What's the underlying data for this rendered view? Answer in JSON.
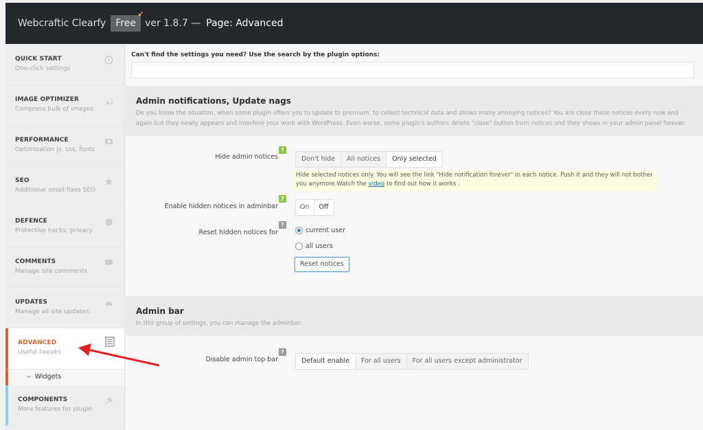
{
  "header": {
    "brand": "Webcraftic Clearfy",
    "badge": "Free",
    "version": "ver 1.8.7 —",
    "page": "Page: Advanced"
  },
  "sidebar": {
    "items": [
      {
        "title": "QUICK START",
        "sub": "One-click settings",
        "icon": "clock-icon"
      },
      {
        "title": "IMAGE OPTIMIZER",
        "sub": "Compress bulk of images",
        "icon": "image-icon"
      },
      {
        "title": "PERFORMANCE",
        "sub": "Optimization js, css, fonts",
        "icon": "dashboard-icon"
      },
      {
        "title": "SEO",
        "sub": "Additional small fixes SEO",
        "icon": "star-icon"
      },
      {
        "title": "DEFENCE",
        "sub": "Protective hacks, privacy",
        "icon": "shield-icon"
      },
      {
        "title": "COMMENTS",
        "sub": "Manage site comments",
        "icon": "comment-icon"
      },
      {
        "title": "UPDATES",
        "sub": "Manage all site updates",
        "icon": "cloud-icon"
      },
      {
        "title": "ADVANCED",
        "sub": "Useful tweaks",
        "icon": "list-icon",
        "active": true
      },
      {
        "title": "COMPONENTS",
        "sub": "More features for plugin",
        "icon": "plugin-icon"
      }
    ],
    "subitem": "Widgets",
    "subitem_prefix": "↪"
  },
  "search": {
    "label": "Can't find the settings you need? Use the search by the plugin options:",
    "value": "",
    "placeholder": ""
  },
  "groups": {
    "notifications": {
      "title": "Admin notifications, Update nags",
      "desc": "Do you know the situation, when some plugin offers you to update to premium, to collect technical data and shows many annoying notices? You are close these notices every now and again but they newly appears and interfere your work with WordPress. Even worse, some plugin's authors delete \"close\" button from notices and they shows in your admin panel forever."
    },
    "adminbar": {
      "title": "Admin bar",
      "desc": "In this group of settings, you can manage the adminbar."
    }
  },
  "settings": {
    "hide_notices": {
      "label": "Hide admin notices",
      "help": "?",
      "options": [
        "Don't hide",
        "All notices",
        "Only selected"
      ],
      "selected": "Only selected",
      "hint_before": "Hide selected notices only. You will see the link \"Hide notification forever\" in each notice. Push it and they will not bother you anymore.Watch the ",
      "hint_link": "video",
      "hint_after": " to find out how it works ."
    },
    "hidden_in_adminbar": {
      "label": "Enable hidden notices in adminbar",
      "help": "?",
      "options": [
        "On",
        "Off"
      ],
      "selected": "Off"
    },
    "reset_for": {
      "label": "Reset hidden notices for",
      "help": "?",
      "options": [
        "current user",
        "all users"
      ],
      "selected": "current user",
      "button": "Reset notices"
    },
    "disable_top_bar": {
      "label": "Disable admin top bar",
      "help": "?",
      "options": [
        "Default enable",
        "For all users",
        "For all users except administrator"
      ],
      "selected": "Default enable"
    }
  },
  "colors": {
    "header_bg": "#23282d",
    "active_accent": "#d5632d",
    "components_accent": "#8ecbf0",
    "help_green": "#8bc34a",
    "annotation_arrow": "#e02020"
  }
}
